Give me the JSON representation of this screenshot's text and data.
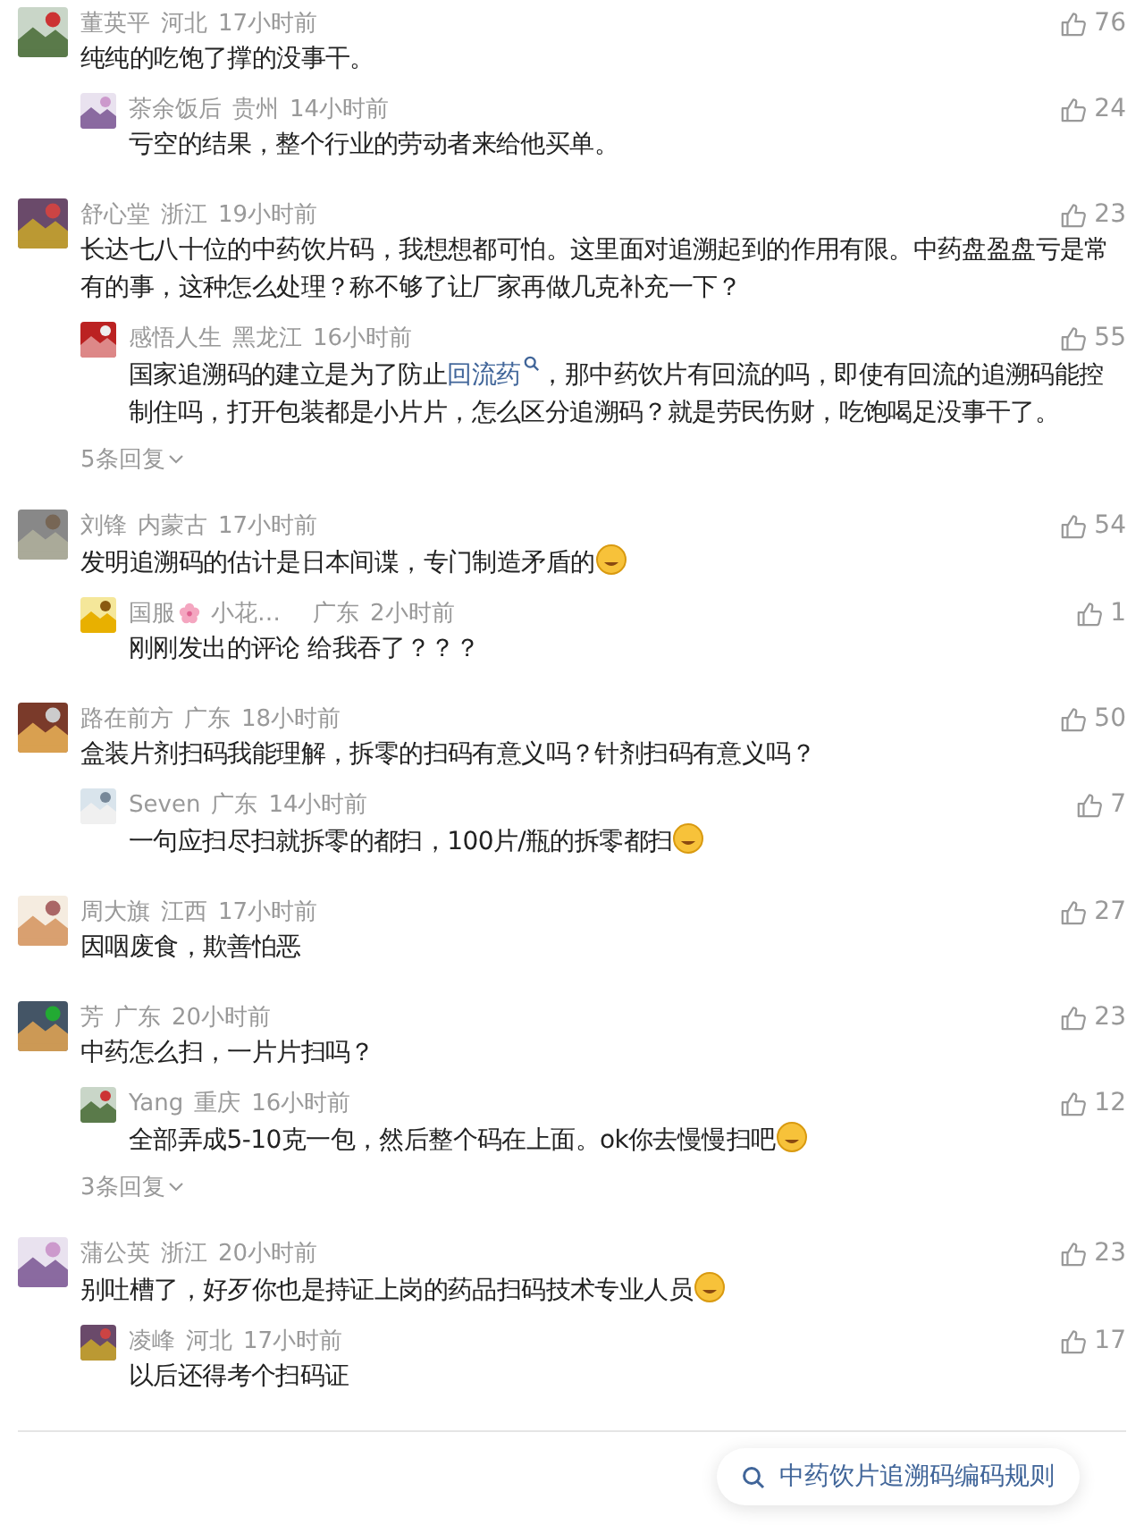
{
  "comments": [
    {
      "name": "董英平",
      "region": "河北",
      "time": "17小时前",
      "likes": "76",
      "text": [
        {
          "kind": "plain",
          "text": "纯纯的吃饱了撑的没事干。"
        }
      ],
      "replies": [
        {
          "name": "茶余饭后",
          "region": "贵州",
          "time": "14小时前",
          "likes": "24",
          "text": [
            {
              "kind": "plain",
              "text": "亏空的结果，整个行业的劳动者来给他买单。"
            }
          ]
        }
      ]
    },
    {
      "name": "舒心堂",
      "region": "浙江",
      "time": "19小时前",
      "likes": "23",
      "text": [
        {
          "kind": "plain",
          "text": "长达七八十位的中药饮片码，我想想都可怕。这里面对追溯起到的作用有限。中药盘盈盘亏是常有的事，这种怎么处理？称不够了让厂家再做几克补充一下？"
        }
      ],
      "replies": [
        {
          "name": "感悟人生",
          "region": "黑龙江",
          "time": "16小时前",
          "likes": "55",
          "text": [
            {
              "kind": "plain",
              "text": "国家追溯码的建立是为了防止"
            },
            {
              "kind": "link",
              "text": "回流药"
            },
            {
              "kind": "plain",
              "text": "，那中药饮片有回流的吗，即使有回流的追溯码能控制住吗，打开包装都是小片片，怎么区分追溯码？就是劳民伤财，吃饱喝足没事干了。"
            }
          ]
        }
      ],
      "more_replies": "5条回复"
    },
    {
      "name": "刘锋",
      "region": "内蒙古",
      "time": "17小时前",
      "likes": "54",
      "text": [
        {
          "kind": "plain",
          "text": "发明追溯码的估计是日本间谍，专门制造矛盾的"
        },
        {
          "kind": "emoji"
        }
      ],
      "replies": [
        {
          "name": "国服",
          "name_tail": "小花…",
          "region": "广东",
          "time": "2小时前",
          "likes": "1",
          "text": [
            {
              "kind": "plain",
              "text": "刚刚发出的评论  给我吞了？？？"
            }
          ]
        }
      ]
    },
    {
      "name": "路在前方",
      "region": "广东",
      "time": "18小时前",
      "likes": "50",
      "text": [
        {
          "kind": "plain",
          "text": "盒装片剂扫码我能理解，拆零的扫码有意义吗？针剂扫码有意义吗？"
        }
      ],
      "replies": [
        {
          "name": "Seven",
          "region": "广东",
          "time": "14小时前",
          "likes": "7",
          "text": [
            {
              "kind": "plain",
              "text": "一句应扫尽扫就拆零的都扫，100片/瓶的拆零都扫"
            },
            {
              "kind": "emoji"
            }
          ]
        }
      ]
    },
    {
      "name": "周大旗",
      "region": "江西",
      "time": "17小时前",
      "likes": "27",
      "text": [
        {
          "kind": "plain",
          "text": "因咽废食，欺善怕恶"
        }
      ]
    },
    {
      "name": "芳",
      "region": "广东",
      "time": "20小时前",
      "likes": "23",
      "text": [
        {
          "kind": "plain",
          "text": "中药怎么扫，一片片扫吗？"
        }
      ],
      "replies": [
        {
          "name": "Yang",
          "region": "重庆",
          "time": "16小时前",
          "likes": "12",
          "text": [
            {
              "kind": "plain",
              "text": "全部弄成5-10克一包，然后整个码在上面。ok你去慢慢扫吧"
            },
            {
              "kind": "emoji"
            }
          ]
        }
      ],
      "more_replies": "3条回复"
    },
    {
      "name": "蒲公英",
      "region": "浙江",
      "time": "20小时前",
      "likes": "23",
      "text": [
        {
          "kind": "plain",
          "text": "别吐槽了，好歹你也是持证上岗的药品扫码技术专业人员"
        },
        {
          "kind": "emoji"
        }
      ],
      "replies": [
        {
          "name": "凌峰",
          "region": "河北",
          "time": "17小时前",
          "likes": "17",
          "text": [
            {
              "kind": "plain",
              "text": "以后还得考个扫码证"
            }
          ]
        }
      ]
    }
  ],
  "search_suggestion": "中药饮片追溯码编码规则"
}
